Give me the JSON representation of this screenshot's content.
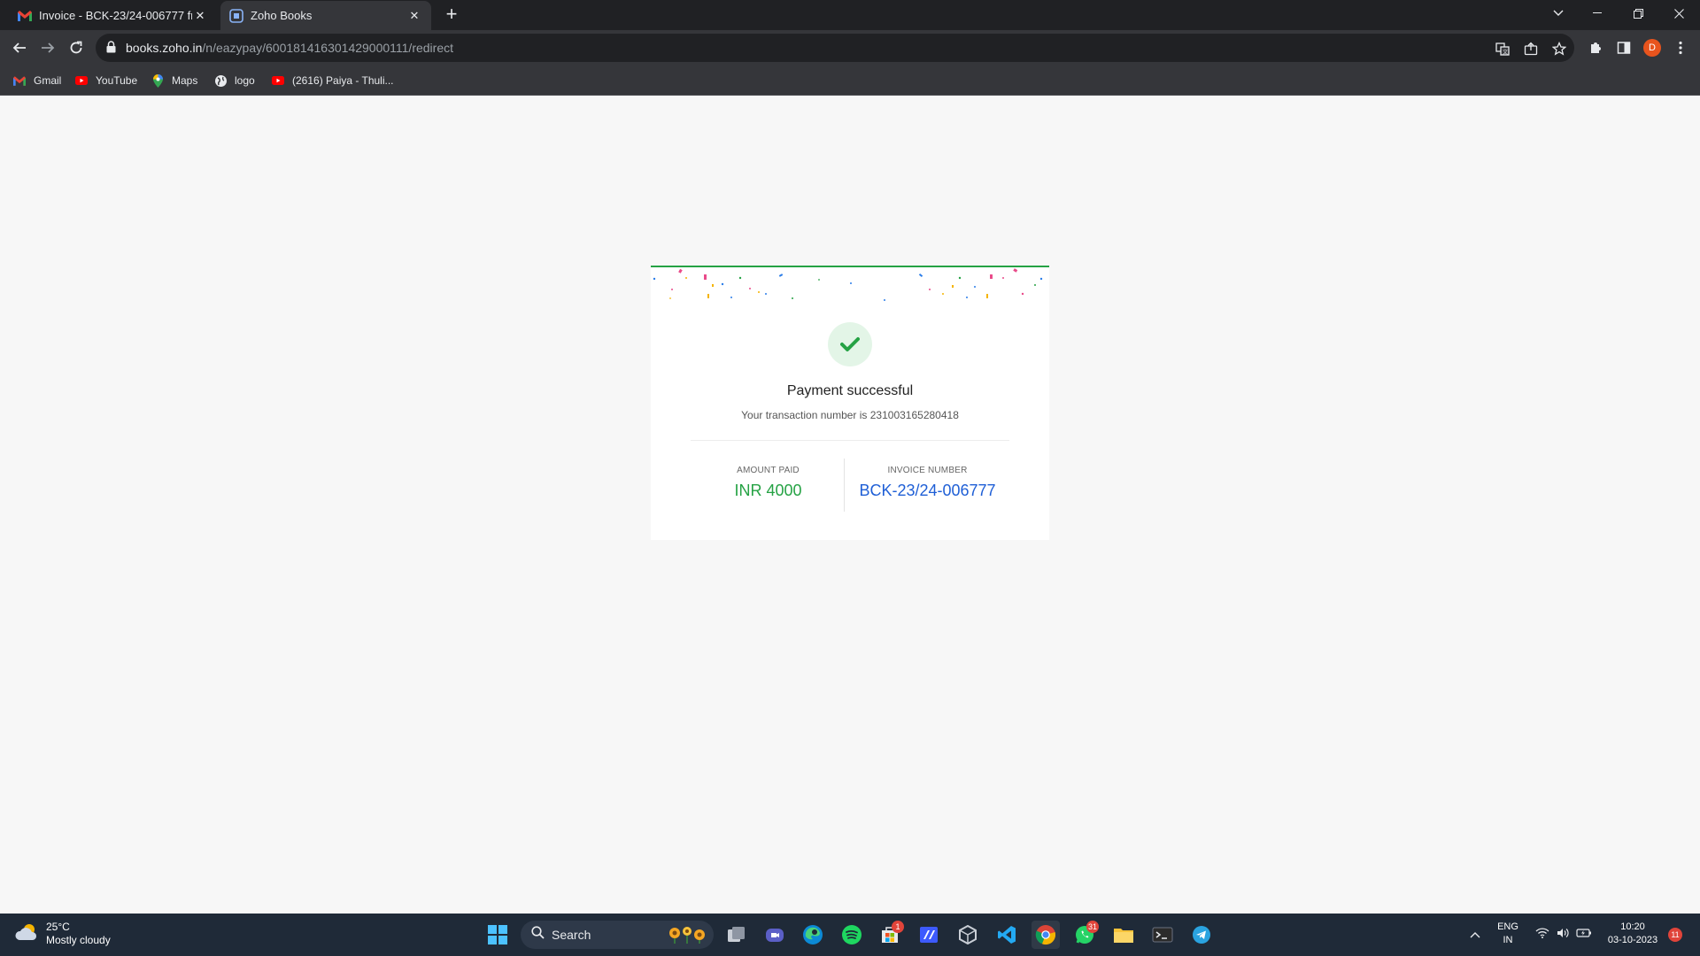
{
  "browser": {
    "tabs": [
      {
        "label": "Invoice - BCK-23/24-006777 fro",
        "favicon": "gmail-icon",
        "active": false
      },
      {
        "label": "Zoho Books",
        "favicon": "zoho-books-icon",
        "active": true
      }
    ],
    "address": {
      "host": "books.zoho.in",
      "path": "/n/eazypay/600181416301429000111/redirect"
    },
    "profile_initial": "D",
    "bookmarks": [
      {
        "label": "Gmail",
        "icon": "gmail-icon"
      },
      {
        "label": "YouTube",
        "icon": "youtube-icon"
      },
      {
        "label": "Maps",
        "icon": "maps-icon"
      },
      {
        "label": "logo",
        "icon": "globe-icon"
      },
      {
        "label": "(2616) Paiya - Thuli...",
        "icon": "youtube-icon"
      }
    ]
  },
  "payment": {
    "title": "Payment successful",
    "transaction_text": "Your transaction number is 231003165280418",
    "amount_label": "AMOUNT PAID",
    "amount_value": "INR 4000",
    "invoice_label": "INVOICE NUMBER",
    "invoice_value": "BCK-23/24-006777"
  },
  "taskbar": {
    "weather_temp": "25°C",
    "weather_desc": "Mostly cloudy",
    "search_label": "Search",
    "badges": {
      "store": "1",
      "whatsapp": "31",
      "notifications": "11"
    },
    "language": "ENG",
    "region": "IN",
    "time": "10:20",
    "date": "03-10-2023"
  },
  "colors": {
    "success": "#25a244",
    "link": "#1f5fd6",
    "taskbar": "#1f2a38",
    "chrome_dark": "#202124"
  }
}
